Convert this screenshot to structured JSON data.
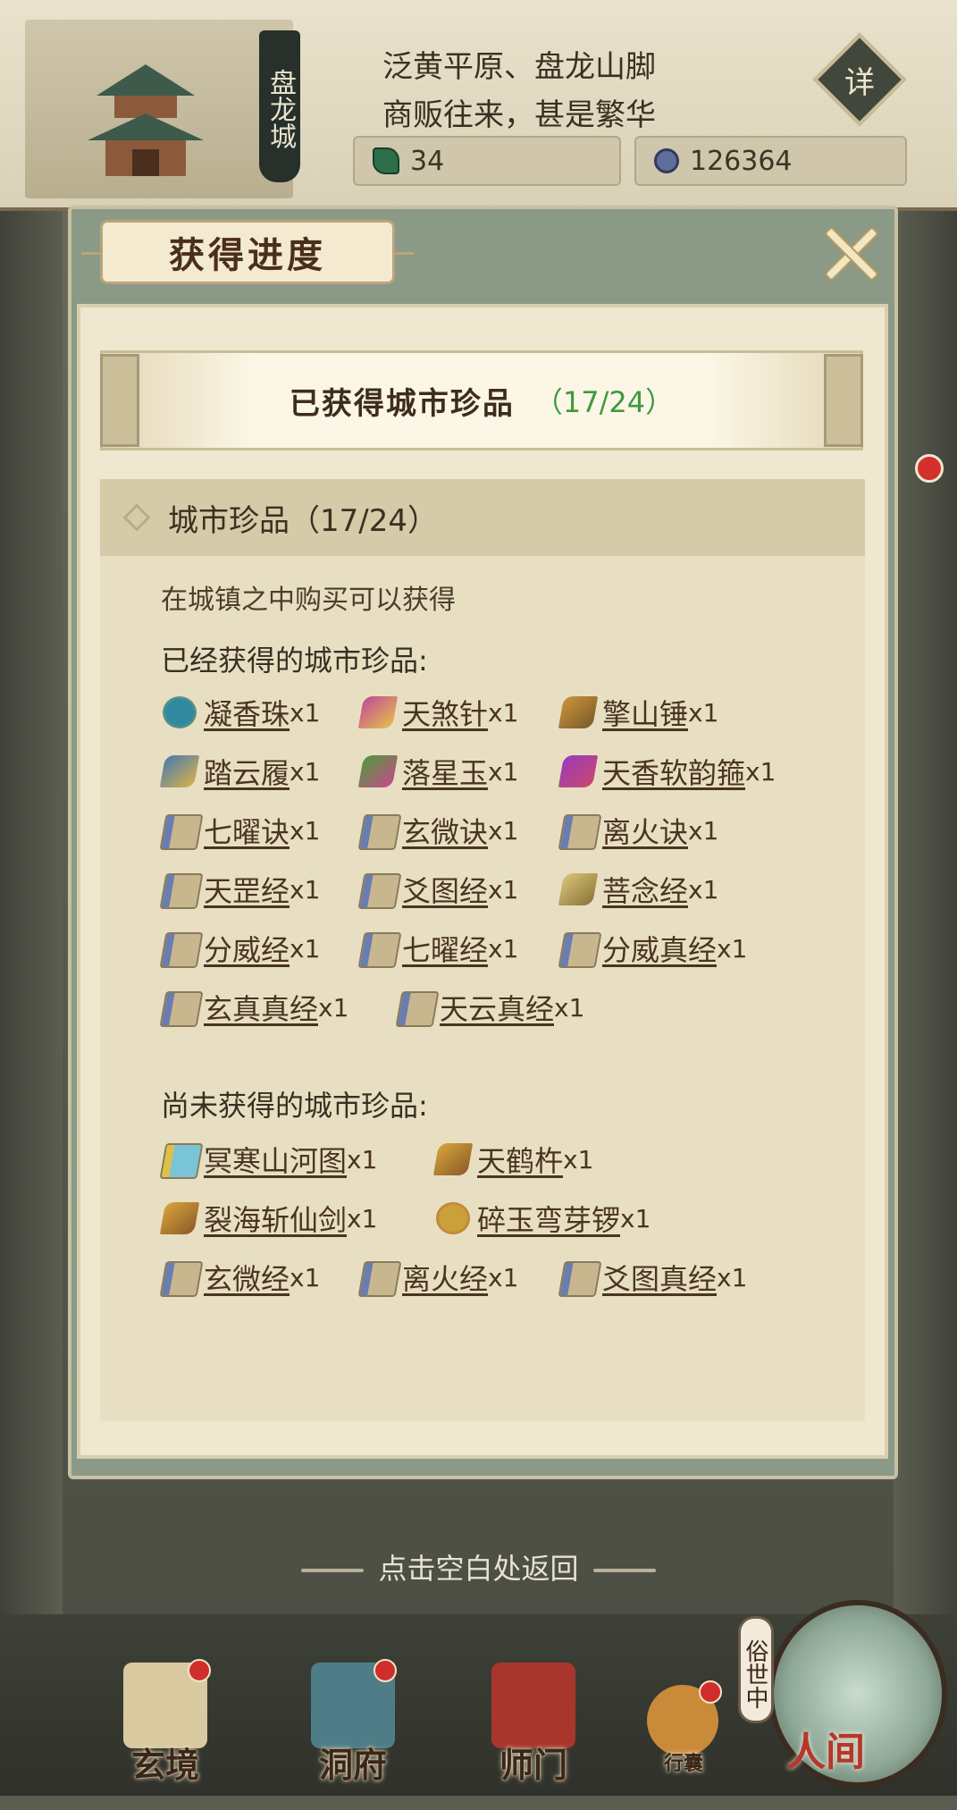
{
  "header": {
    "city_name": "盘龙城",
    "desc_line1": "泛黄平原、盘龙山脚",
    "desc_line2": "商贩往来，甚是繁华",
    "detail_label": "详",
    "jade_count": "34",
    "coin_count": "126364"
  },
  "modal": {
    "title": "获得进度",
    "banner_label": "已获得城市珍品",
    "banner_count": "（17/24）",
    "section_title": "城市珍品（17/24）",
    "hint": "在城镇之中购买可以获得",
    "obtained_title": "已经获得的城市珍品:",
    "missing_title": "尚未获得的城市珍品:",
    "obtained": [
      {
        "name": "凝香珠",
        "qty": "x1",
        "icon": "orb-icon"
      },
      {
        "name": "天煞针",
        "qty": "x1",
        "icon": "needle-icon"
      },
      {
        "name": "擎山锤",
        "qty": "x1",
        "icon": "hammer-icon"
      },
      {
        "name": "踏云履",
        "qty": "x1",
        "icon": "boots-icon"
      },
      {
        "name": "落星玉",
        "qty": "x1",
        "icon": "jade-icon"
      },
      {
        "name": "天香软韵箍",
        "qty": "x1",
        "icon": "ring-icon"
      },
      {
        "name": "七曜诀",
        "qty": "x1",
        "icon": "scroll-icon"
      },
      {
        "name": "玄微诀",
        "qty": "x1",
        "icon": "scroll-icon"
      },
      {
        "name": "离火诀",
        "qty": "x1",
        "icon": "scroll-icon"
      },
      {
        "name": "天罡经",
        "qty": "x1",
        "icon": "scroll-icon"
      },
      {
        "name": "爻图经",
        "qty": "x1",
        "icon": "scroll-icon"
      },
      {
        "name": "菩念经",
        "qty": "x1",
        "icon": "book-icon"
      },
      {
        "name": "分威经",
        "qty": "x1",
        "icon": "scroll-icon"
      },
      {
        "name": "七曜经",
        "qty": "x1",
        "icon": "scroll-icon"
      },
      {
        "name": "分威真经",
        "qty": "x1",
        "icon": "scroll-icon"
      },
      {
        "name": "玄真真经",
        "qty": "x1",
        "icon": "scroll-icon"
      },
      {
        "name": "天云真经",
        "qty": "x1",
        "icon": "scroll-icon"
      }
    ],
    "missing": [
      {
        "name": "冥寒山河图",
        "qty": "x1",
        "icon": "map-scroll-icon"
      },
      {
        "name": "天鹤杵",
        "qty": "x1",
        "icon": "pestle-icon"
      },
      {
        "name": "裂海斩仙剑",
        "qty": "x1",
        "icon": "sword-icon"
      },
      {
        "name": "碎玉弯芽锣",
        "qty": "x1",
        "icon": "gong-icon"
      },
      {
        "name": "玄微经",
        "qty": "x1",
        "icon": "scroll-icon"
      },
      {
        "name": "离火经",
        "qty": "x1",
        "icon": "scroll-icon"
      },
      {
        "name": "爻图真经",
        "qty": "x1",
        "icon": "scroll-icon"
      }
    ],
    "back_hint": "点击空白处返回"
  },
  "nav": {
    "xuanjing": "玄境",
    "dongfu": "洞府",
    "shimen": "师门",
    "xingnang": "行囊",
    "world_tag": "俗世中",
    "renjian": "人间"
  },
  "colors": {
    "accent_green": "#3f9a3f",
    "badge_red": "#d02e2a",
    "panel_bg": "#e8dfc3"
  }
}
